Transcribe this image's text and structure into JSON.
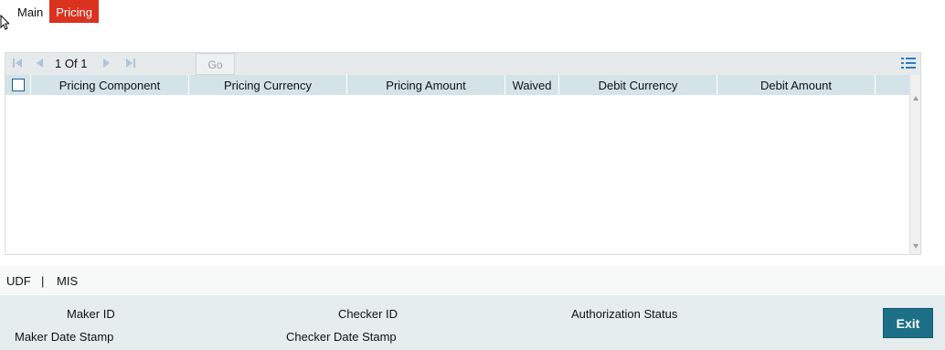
{
  "tabs": [
    {
      "label": "Main",
      "active": false
    },
    {
      "label": "Pricing",
      "active": true
    }
  ],
  "grid": {
    "pager": {
      "current": "1",
      "of_label": "Of",
      "total": "1"
    },
    "go_label": "Go",
    "columns": [
      "Pricing Component",
      "Pricing Currency",
      "Pricing Amount",
      "Waived",
      "Debit Currency",
      "Debit Amount"
    ],
    "rows": []
  },
  "links": {
    "udf": "UDF",
    "separator": "|",
    "mis": "MIS"
  },
  "footer": {
    "maker_id_label": "Maker ID",
    "maker_date_label": "Maker Date Stamp",
    "checker_id_label": "Checker ID",
    "checker_date_label": "Checker Date Stamp",
    "auth_status_label": "Authorization Status",
    "exit_label": "Exit"
  },
  "colors": {
    "active_tab": "#d9321f",
    "header_row": "#d4e3e8",
    "exit_button": "#1c6f86",
    "footer_bg": "#e5edef"
  }
}
